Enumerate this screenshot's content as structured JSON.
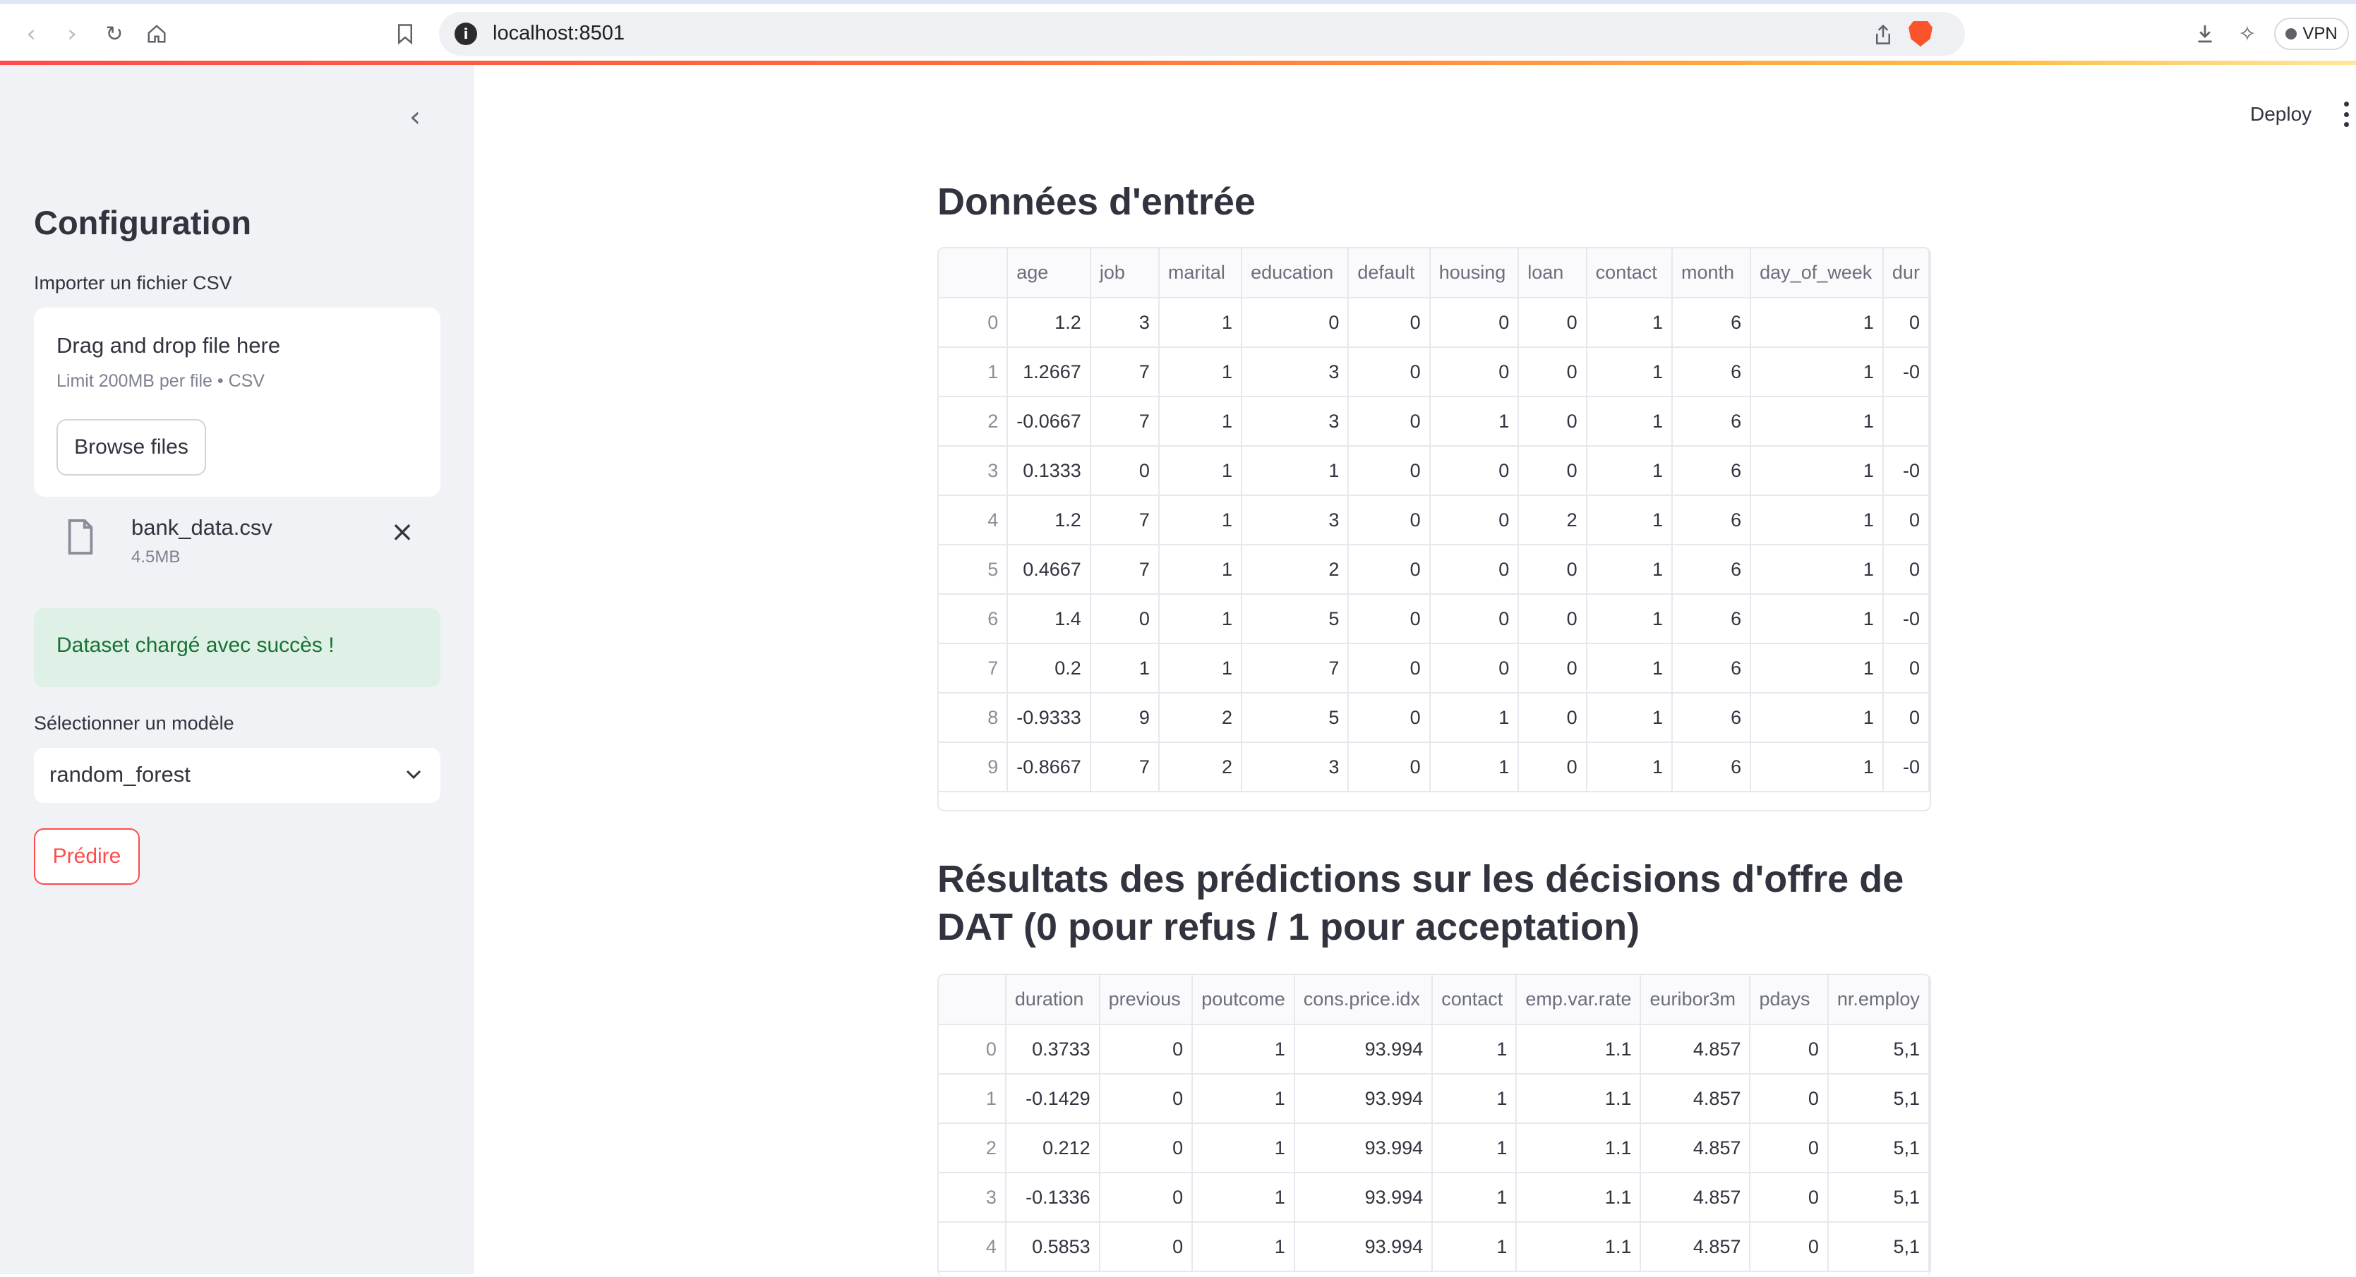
{
  "browser": {
    "url": "localhost:8501",
    "vpn_label": "VPN"
  },
  "header": {
    "deploy_label": "Deploy"
  },
  "sidebar": {
    "title": "Configuration",
    "upload_label": "Importer un fichier CSV",
    "dropzone_title": "Drag and drop file here",
    "dropzone_limit": "Limit 200MB per file • CSV",
    "browse_label": "Browse files",
    "file_name": "bank_data.csv",
    "file_size": "4.5MB",
    "success_message": "Dataset chargé avec succès !",
    "model_label": "Sélectionner un modèle",
    "model_value": "random_forest",
    "predict_label": "Prédire"
  },
  "main": {
    "input_title": "Données d'entrée",
    "input_table": {
      "columns": [
        "age",
        "job",
        "marital",
        "education",
        "default",
        "housing",
        "loan",
        "contact",
        "month",
        "day_of_week",
        "dur"
      ],
      "rows": [
        [
          "0",
          "1.2",
          "3",
          "1",
          "0",
          "0",
          "0",
          "0",
          "1",
          "6",
          "1",
          "0"
        ],
        [
          "1",
          "1.2667",
          "7",
          "1",
          "3",
          "0",
          "0",
          "0",
          "1",
          "6",
          "1",
          "-0"
        ],
        [
          "2",
          "-0.0667",
          "7",
          "1",
          "3",
          "0",
          "1",
          "0",
          "1",
          "6",
          "1",
          ""
        ],
        [
          "3",
          "0.1333",
          "0",
          "1",
          "1",
          "0",
          "0",
          "0",
          "1",
          "6",
          "1",
          "-0"
        ],
        [
          "4",
          "1.2",
          "7",
          "1",
          "3",
          "0",
          "0",
          "2",
          "1",
          "6",
          "1",
          "0"
        ],
        [
          "5",
          "0.4667",
          "7",
          "1",
          "2",
          "0",
          "0",
          "0",
          "1",
          "6",
          "1",
          "0"
        ],
        [
          "6",
          "1.4",
          "0",
          "1",
          "5",
          "0",
          "0",
          "0",
          "1",
          "6",
          "1",
          "-0"
        ],
        [
          "7",
          "0.2",
          "1",
          "1",
          "7",
          "0",
          "0",
          "0",
          "1",
          "6",
          "1",
          "0"
        ],
        [
          "8",
          "-0.9333",
          "9",
          "2",
          "5",
          "0",
          "1",
          "0",
          "1",
          "6",
          "1",
          "0"
        ],
        [
          "9",
          "-0.8667",
          "7",
          "2",
          "3",
          "0",
          "1",
          "0",
          "1",
          "6",
          "1",
          "-0"
        ]
      ]
    },
    "results_title": "Résultats des prédictions sur les décisions d'offre de DAT (0 pour refus / 1 pour acceptation)",
    "results_table": {
      "columns": [
        "duration",
        "previous",
        "poutcome",
        "cons.price.idx",
        "contact",
        "emp.var.rate",
        "euribor3m",
        "pdays",
        "nr.employ"
      ],
      "rows": [
        [
          "0",
          "0.3733",
          "0",
          "1",
          "93.994",
          "1",
          "1.1",
          "4.857",
          "0",
          "5,1"
        ],
        [
          "1",
          "-0.1429",
          "0",
          "1",
          "93.994",
          "1",
          "1.1",
          "4.857",
          "0",
          "5,1"
        ],
        [
          "2",
          "0.212",
          "0",
          "1",
          "93.994",
          "1",
          "1.1",
          "4.857",
          "0",
          "5,1"
        ],
        [
          "3",
          "-0.1336",
          "0",
          "1",
          "93.994",
          "1",
          "1.1",
          "4.857",
          "0",
          "5,1"
        ],
        [
          "4",
          "0.5853",
          "0",
          "1",
          "93.994",
          "1",
          "1.1",
          "4.857",
          "0",
          "5,1"
        ]
      ]
    }
  }
}
